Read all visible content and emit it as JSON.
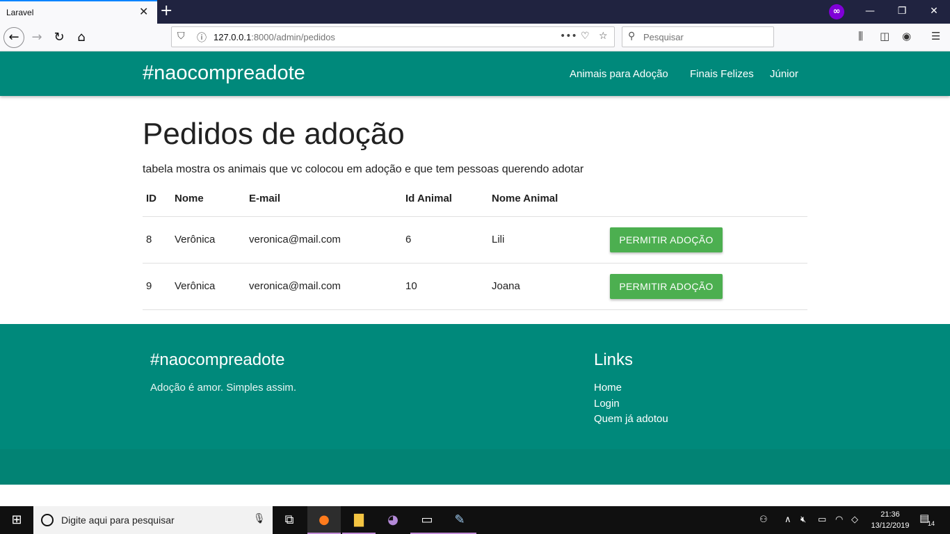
{
  "browser": {
    "tab_title": "Laravel",
    "tab_close": "✕",
    "new_tab": "+",
    "url_host": "127.0.0.1",
    "url_rest": ":8000/admin/pedidos",
    "search_placeholder": "Pesquisar",
    "private_icon": "∞"
  },
  "site": {
    "brand": "#naocompreadote",
    "menu": [
      "Animais para Adoção",
      "Finais Felizes",
      "Júnior"
    ]
  },
  "main": {
    "title": "Pedidos de adoção",
    "subtitle": "tabela mostra os animais que vc colocou em adoção e que tem pessoas querendo adotar",
    "table": {
      "headers": [
        "ID",
        "Nome",
        "E-mail",
        "Id Animal",
        "Nome Animal"
      ],
      "rows": [
        {
          "id": "8",
          "nome": "Verônica",
          "email": "veronica@mail.com",
          "id_animal": "6",
          "nome_animal": "Lili",
          "action": "PERMITIR ADOÇÃO"
        },
        {
          "id": "9",
          "nome": "Verônica",
          "email": "veronica@mail.com",
          "id_animal": "10",
          "nome_animal": "Joana",
          "action": "PERMITIR ADOÇÃO"
        }
      ]
    }
  },
  "footer": {
    "brand": "#naocompreadote",
    "tagline": "Adoção é amor. Simples assim.",
    "links_title": "Links",
    "links": [
      "Home",
      "Login",
      "Quem já adotou"
    ]
  },
  "taskbar": {
    "search_placeholder": "Digite aqui para pesquisar",
    "time": "21:36",
    "date": "13/12/2019",
    "notification_count": "14"
  },
  "colors": {
    "primary": "#00897b",
    "button": "#4caf50",
    "chrome_dark": "#202340"
  }
}
